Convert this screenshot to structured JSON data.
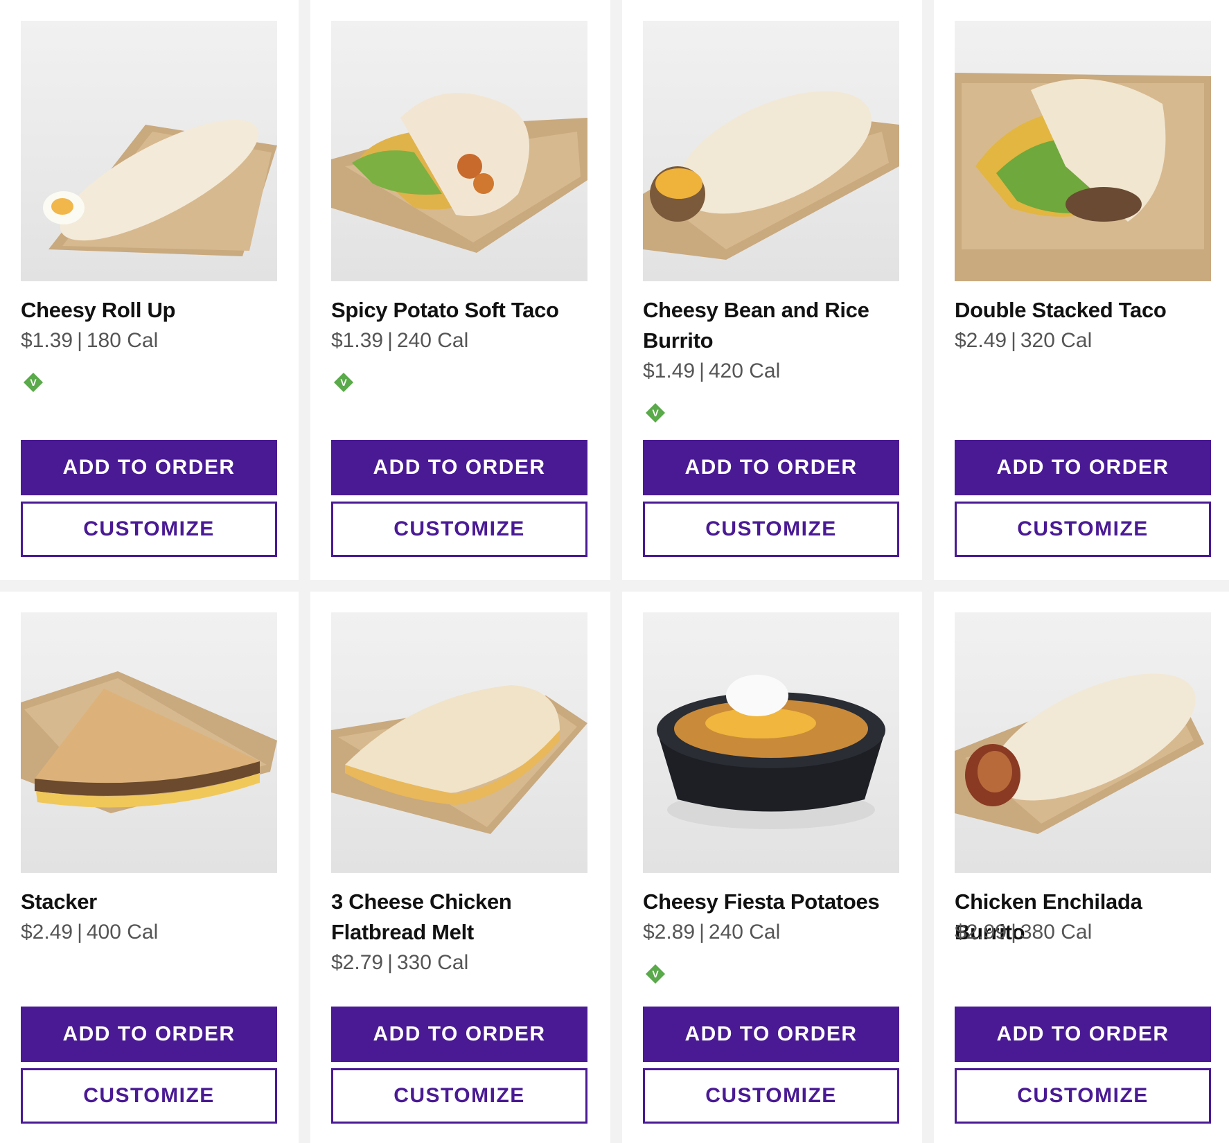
{
  "colors": {
    "brand_purple": "#4a1a94",
    "vegetarian_green": "#5aa94a",
    "page_background": "#f2f2f2"
  },
  "buttons": {
    "add_label": "ADD TO ORDER",
    "customize_label": "CUSTOMIZE"
  },
  "vegetarian_badge": {
    "icon": "vegetarian-icon",
    "letter": "V"
  },
  "items": [
    {
      "name": "Cheesy Roll Up",
      "price": "$1.39",
      "calories": "180 Cal",
      "vegetarian": true
    },
    {
      "name": "Spicy Potato Soft Taco",
      "price": "$1.39",
      "calories": "240 Cal",
      "vegetarian": true
    },
    {
      "name": "Cheesy Bean and Rice Burrito",
      "price": "$1.49",
      "calories": "420 Cal",
      "vegetarian": true
    },
    {
      "name": "Double Stacked Taco",
      "price": "$2.49",
      "calories": "320 Cal",
      "vegetarian": false
    },
    {
      "name": "Stacker",
      "price": "$2.49",
      "calories": "400 Cal",
      "vegetarian": false
    },
    {
      "name": "3 Cheese Chicken Flatbread Melt",
      "price": "$2.79",
      "calories": "330 Cal",
      "vegetarian": false
    },
    {
      "name": "Cheesy Fiesta Potatoes",
      "price": "$2.89",
      "calories": "240 Cal",
      "vegetarian": true
    },
    {
      "name": "Chicken Enchilada Burrito",
      "price": "$2.99",
      "calories": "380 Cal",
      "vegetarian": false
    }
  ]
}
